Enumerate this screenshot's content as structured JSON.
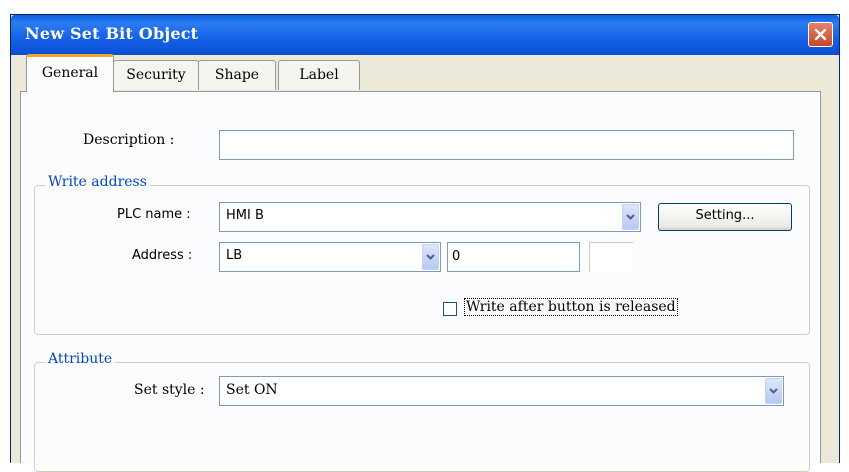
{
  "window": {
    "title": "New  Set Bit Object"
  },
  "tabs": [
    {
      "label": "General",
      "active": true
    },
    {
      "label": "Security"
    },
    {
      "label": "Shape"
    },
    {
      "label": "Label"
    }
  ],
  "general": {
    "description": {
      "label": "Description :",
      "value": ""
    },
    "write_address": {
      "title": "Write address",
      "plc_name": {
        "label": "PLC name :",
        "value": "HMI B"
      },
      "setting_button": "Setting...",
      "address": {
        "label": "Address :",
        "type": "LB",
        "value": "0",
        "extra": ""
      },
      "write_after_release": {
        "label": "Write after button is released",
        "checked": false
      }
    },
    "attribute": {
      "title": "Attribute",
      "set_style": {
        "label": "Set style :",
        "value": "Set ON"
      }
    }
  },
  "colors": {
    "title_bar": "#0a5fe0",
    "close_button": "#d2553a",
    "active_tab_accent": "#f5a52c",
    "group_title": "#0046d5"
  },
  "icons": {
    "close": "close-icon",
    "dropdown": "chevron-down-icon"
  }
}
